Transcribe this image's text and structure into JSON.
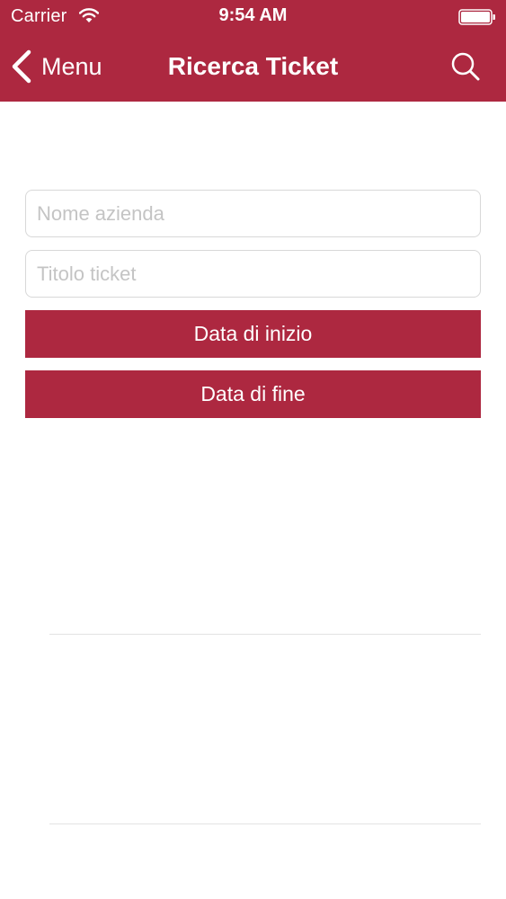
{
  "status_bar": {
    "carrier": "Carrier",
    "time": "9:54 AM"
  },
  "nav": {
    "back_label": "Menu",
    "title": "Ricerca Ticket"
  },
  "form": {
    "company_field": {
      "placeholder": "Nome azienda",
      "value": ""
    },
    "title_field": {
      "placeholder": "Titolo ticket",
      "value": ""
    },
    "start_date_label": "Data di inizio",
    "end_date_label": "Data di fine"
  },
  "icons": {
    "wifi": "wifi-icon",
    "battery": "battery-icon",
    "back": "chevron-left-icon",
    "search": "search-icon"
  },
  "colors": {
    "brand": "#ad2840",
    "background": "#ffffff",
    "on_brand_text": "#ffffff",
    "field_border": "#d8d8d8",
    "placeholder": "#c4c4c4",
    "separator": "#e3e3e3"
  }
}
